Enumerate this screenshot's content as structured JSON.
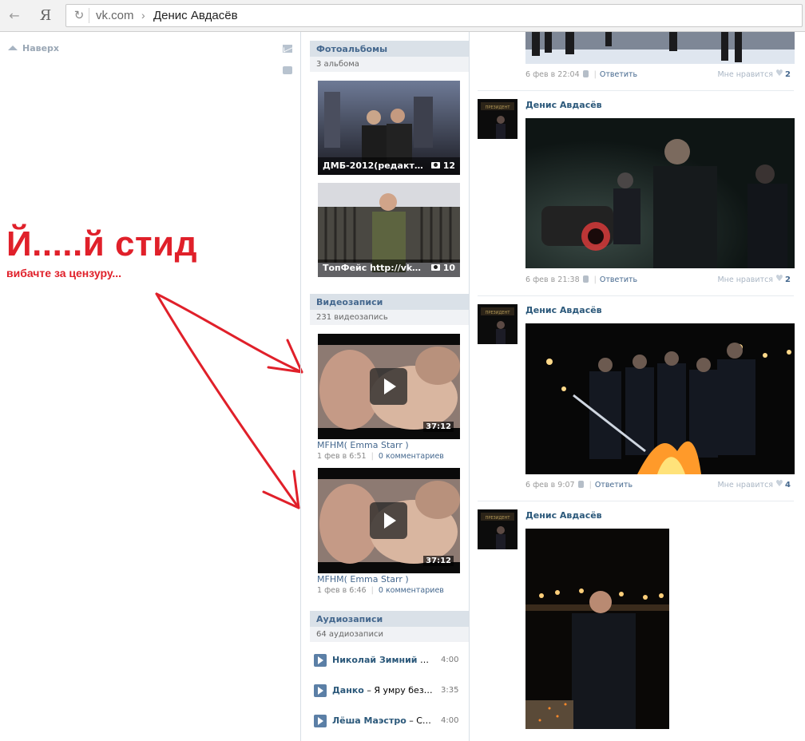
{
  "browser": {
    "back_glyph": "←",
    "logo": "Я",
    "reload_glyph": "↻",
    "domain": "vk.com",
    "separator": "›",
    "page_title": "Денис Авдасёв"
  },
  "left_sidebar": {
    "top_link": "Наверх",
    "icons": [
      "mail-icon",
      "chat-icon"
    ]
  },
  "annotation": {
    "title": "Й.....й стид",
    "subtitle": "вибачте за цензуру...",
    "color": "#e0202a"
  },
  "albums_block": {
    "header": "Фотоальбомы",
    "count_label": "3 альбома",
    "albums": [
      {
        "title": "ДМБ-2012(редакт…",
        "count": "12"
      },
      {
        "title": "ТопФейс http://vko…",
        "count": "10"
      }
    ]
  },
  "videos_block": {
    "header": "Видеозаписи",
    "count_label": "231 видеозапись",
    "videos": [
      {
        "duration": "37:12",
        "title": "MFHM( Emma Starr )",
        "date": "1 фев в 6:51",
        "comments": "0 комментариев"
      },
      {
        "duration": "37:12",
        "title": "MFHM( Emma Starr )",
        "date": "1 фев в 6:46",
        "comments": "0 комментариев"
      }
    ]
  },
  "audio_block": {
    "header": "Аудиозаписи",
    "count_label": "64 аудиозаписи",
    "tracks": [
      {
        "artist": "Николай Зимний",
        "title": "– …",
        "duration": "4:00"
      },
      {
        "artist": "Данко",
        "title": "– Я умру без…",
        "duration": "3:35"
      },
      {
        "artist": "Лёша Маэстро",
        "title": "– С…",
        "duration": "4:00"
      }
    ]
  },
  "wall": {
    "reply_label": "Ответить",
    "like_label": "Мне нравится",
    "posts": [
      {
        "author": "",
        "date": "6 фев в 22:04",
        "likes": "2"
      },
      {
        "author": "Денис Авдасёв",
        "date": "6 фев в 21:38",
        "likes": "2"
      },
      {
        "author": "Денис Авдасёв",
        "date": "6 фев в 9:07",
        "likes": "4"
      },
      {
        "author": "Денис Авдасёв",
        "date": "",
        "likes": ""
      }
    ]
  },
  "colors": {
    "link": "#45688e",
    "header_bg": "#dae1e8",
    "annotation": "#e0202a"
  }
}
